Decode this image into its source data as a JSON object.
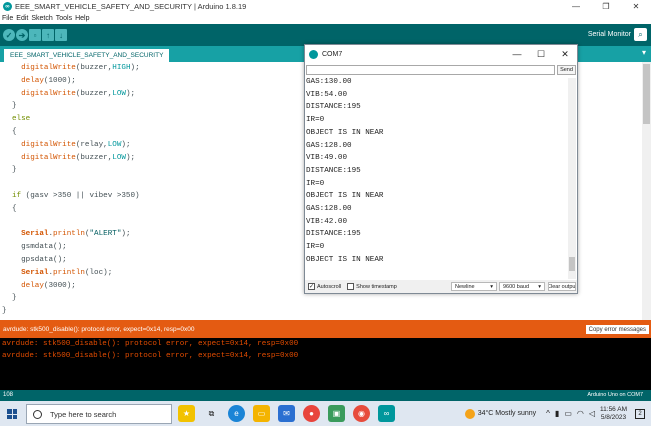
{
  "window": {
    "title": "EEE_SMART_VEHICLE_SAFETY_AND_SECURITY | Arduino 1.8.19"
  },
  "menu": [
    "File",
    "Edit",
    "Sketch",
    "Tools",
    "Help"
  ],
  "toolbar": {
    "serial_monitor_label": "Serial Monitor"
  },
  "tab": {
    "label": "EEE_SMART_VEHICLE_SAFETY_AND_SECURITY"
  },
  "code_lines": [
    "  digitalWrite(buzzer,HIGH);",
    "  delay(1000);",
    "  digitalWrite(buzzer,LOW);",
    "}",
    "else",
    "{",
    "  digitalWrite(relay,LOW);",
    "  digitalWrite(buzzer,LOW);",
    "}",
    "",
    "if (gasv >350 || vibev >350)",
    "{",
    "",
    "  Serial.println(\"ALERT\");",
    "  gsmdata();",
    "  gpsdata();",
    "  Serial.println(loc);",
    "  delay(3000);",
    "}",
    "}"
  ],
  "status": {
    "message": "avrdude: stk500_disable(): protocol error, expect=0x14, resp=0x00",
    "copy_button": "Copy error messages"
  },
  "console": {
    "lines": [
      "avrdude: stk500_disable(): protocol error, expect=0x14, resp=0x00",
      "avrdude: stk500_disable(): protocol error, expect=0x14, resp=0x00"
    ]
  },
  "bottom": {
    "line_number": "108",
    "board": "Arduino Uno on COM7"
  },
  "serial_monitor": {
    "title": "COM7",
    "send_label": "Send",
    "output": [
      "GAS:130.00",
      "VIB:54.00",
      "DISTANCE:195",
      "IR=0",
      "OBJECT IS IN NEAR",
      "GAS:128.00",
      "VIB:49.00",
      "DISTANCE:195",
      "IR=0",
      "OBJECT IS IN NEAR",
      "GAS:128.00",
      "VIB:42.00",
      "DISTANCE:195",
      "IR=0",
      "OBJECT IS IN NEAR"
    ],
    "autoscroll_label": "Autoscroll",
    "autoscroll_checked": true,
    "timestamp_label": "Show timestamp",
    "line_ending": "Newline",
    "baud": "9600 baud",
    "clear_label": "Clear output"
  },
  "taskbar": {
    "search_placeholder": "Type here to search",
    "weather": "34°C  Mostly sunny",
    "time": "11:56 AM",
    "date": "5/8/2023",
    "notification_count": "2"
  },
  "colors": {
    "toolbar": "#006468",
    "tabstrip": "#17a1a5",
    "status_error": "#e45b12",
    "console_bg": "#000000",
    "console_text": "#e34c00"
  }
}
